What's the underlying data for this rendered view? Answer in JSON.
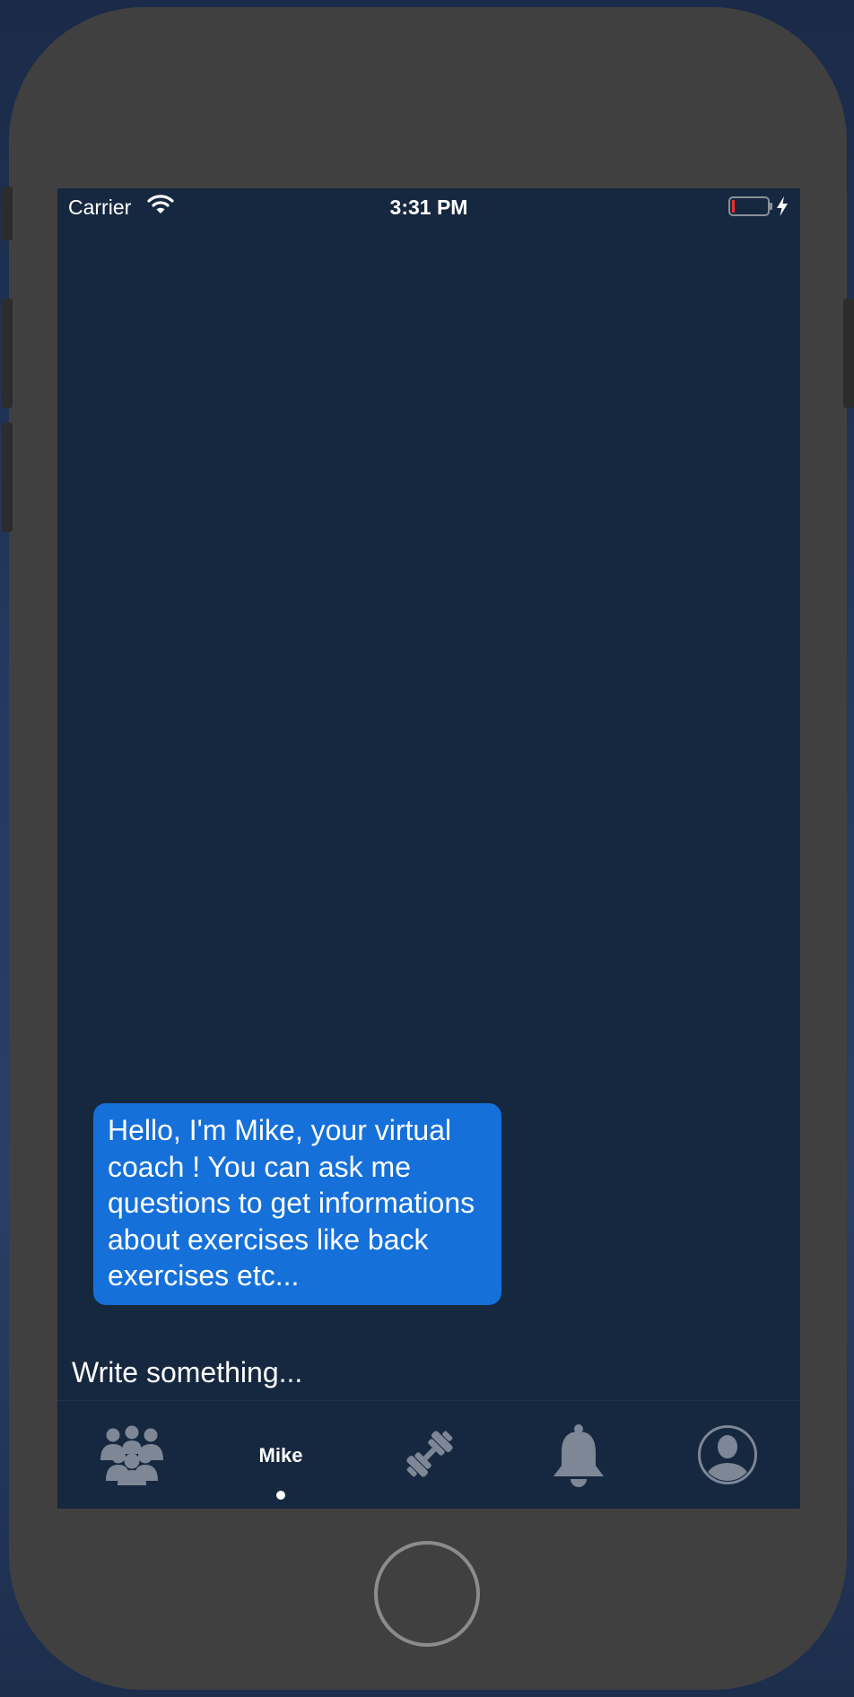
{
  "status_bar": {
    "carrier": "Carrier",
    "time": "3:31 PM",
    "icons": [
      "wifi-icon",
      "battery-low-icon",
      "charging-bolt-icon"
    ]
  },
  "chat": {
    "messages": [
      {
        "sender": "Mike",
        "text": "Hello, I'm Mike, your virtual coach ! You can ask me questions to get informations about exercises like back exercises etc..."
      }
    ],
    "input": {
      "placeholder": "Write something...",
      "value": ""
    }
  },
  "tab_bar": {
    "active_index": 1,
    "tabs": [
      {
        "icon": "community-group-icon",
        "label": ""
      },
      {
        "icon": "",
        "label": "Mike"
      },
      {
        "icon": "dumbbell-icon",
        "label": ""
      },
      {
        "icon": "bell-icon",
        "label": ""
      },
      {
        "icon": "profile-avatar-icon",
        "label": ""
      }
    ]
  },
  "colors": {
    "screen_background": "#162840",
    "bubble_background": "#1570da",
    "inactive_icon": "#7d8795",
    "text": "#ffffff"
  }
}
